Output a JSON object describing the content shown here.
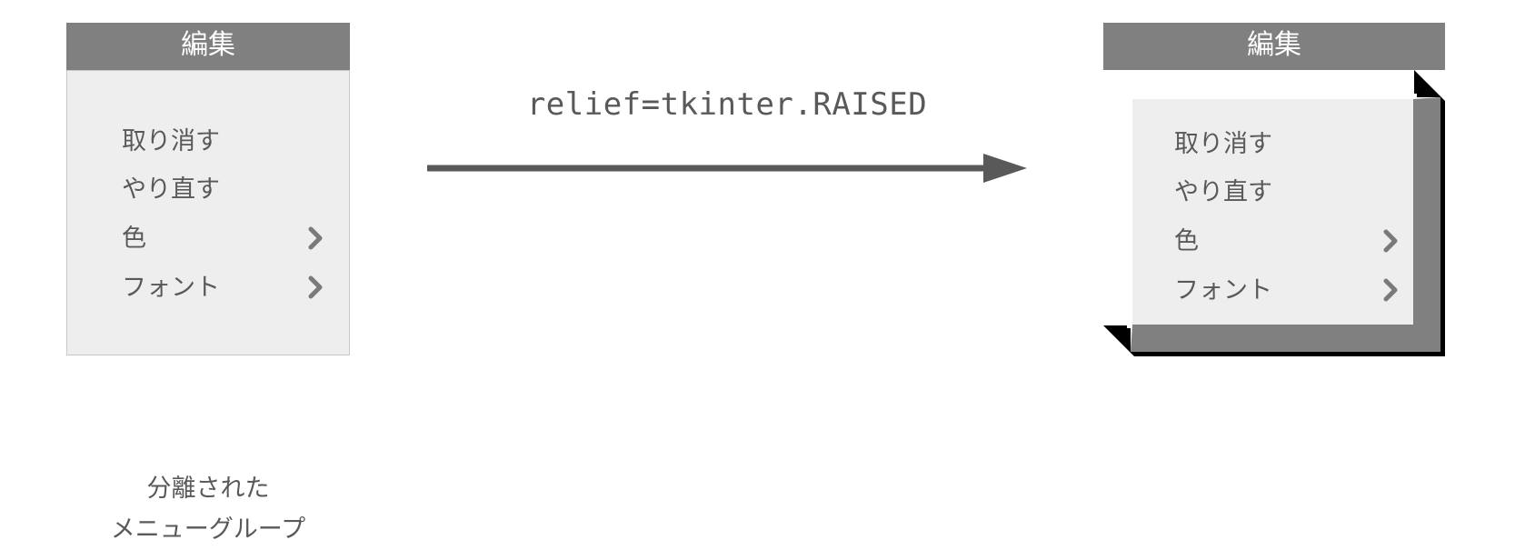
{
  "left": {
    "title": "編集",
    "items": [
      {
        "label": "取り消す",
        "submenu": false
      },
      {
        "label": "やり直す",
        "submenu": false
      },
      {
        "label": "色",
        "submenu": true
      },
      {
        "label": "フォント",
        "submenu": true
      }
    ],
    "caption_line1": "分離された",
    "caption_line2": "メニューグループ"
  },
  "transform": {
    "code": "relief=tkinter.RAISED"
  },
  "right": {
    "title": "編集",
    "items": [
      {
        "label": "取り消す",
        "submenu": false
      },
      {
        "label": "やり直す",
        "submenu": false
      },
      {
        "label": "色",
        "submenu": true
      },
      {
        "label": "フォント",
        "submenu": true
      }
    ]
  }
}
